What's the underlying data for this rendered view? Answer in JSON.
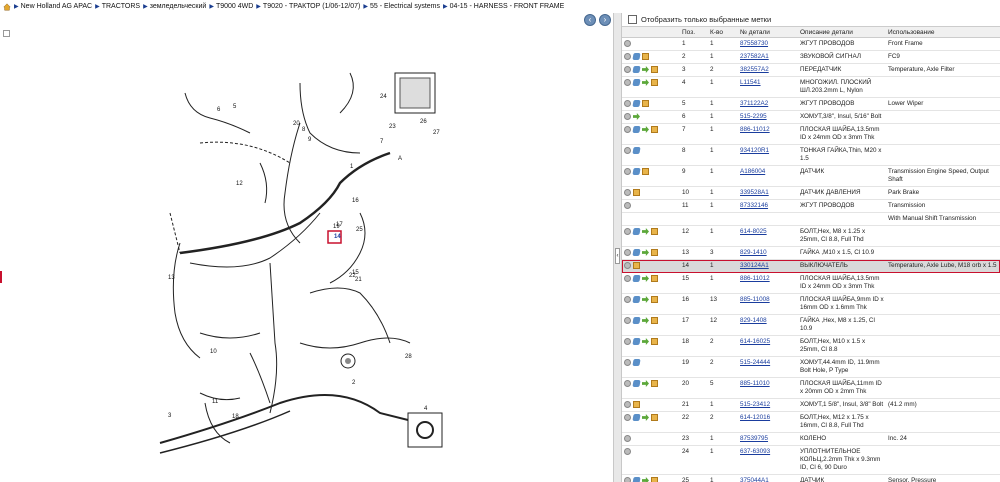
{
  "breadcrumb": [
    "New Holland AG APAC",
    "TRACTORS",
    "земледельческий",
    "T9000 4WD",
    "T9020 - ТРАКТОР (1/06-12/07)",
    "55 - Electrical systems",
    "04-15 - HARNESS - FRONT FRAME"
  ],
  "filter_label": "Отобразить только выбранные метки",
  "columns": [
    "Поз.",
    "К-во",
    "№ детали",
    "Описание детали",
    "Использование"
  ],
  "diagram_labels": [
    "1",
    "2",
    "3",
    "4",
    "5",
    "6",
    "7",
    "8",
    "9",
    "10",
    "11",
    "12",
    "13",
    "14",
    "15",
    "16",
    "17",
    "18",
    "19",
    "20",
    "21",
    "22",
    "23",
    "24",
    "25",
    "26",
    "27",
    "28",
    "A"
  ],
  "selected_pos": "14",
  "rows": [
    {
      "pos": "1",
      "qty": "1",
      "part": "87558730",
      "desc": "ЖГУТ ПРОВОДОВ",
      "use": "Front Frame",
      "icons": [
        "info"
      ]
    },
    {
      "pos": "2",
      "qty": "1",
      "part": "237582A1",
      "desc": "ЗВУКОВОЙ СИГНАЛ",
      "use": "FC9",
      "icons": [
        "info",
        "link",
        "box"
      ]
    },
    {
      "pos": "3",
      "qty": "2",
      "part": "382557A2",
      "desc": "ПЕРЕДАТЧИК",
      "use": "Temperature, Axle Filter",
      "icons": [
        "info",
        "link",
        "arrow",
        "box"
      ]
    },
    {
      "pos": "4",
      "qty": "1",
      "part": "L11541",
      "desc": "МНОГОЖИЛ. ПЛОСКИЙ ШЛ.203.2mm L, Nylon",
      "use": "",
      "icons": [
        "info",
        "link",
        "arrow",
        "box"
      ]
    },
    {
      "pos": "5",
      "qty": "1",
      "part": "371122A2",
      "desc": "ЖГУТ ПРОВОДОВ",
      "use": "Lower Wiper",
      "icons": [
        "info",
        "link",
        "box"
      ]
    },
    {
      "pos": "6",
      "qty": "1",
      "part": "515-2295",
      "desc": "ХОМУТ,3/8\", Insul, 5/16\" Bolt",
      "use": "",
      "icons": [
        "info",
        "arrow"
      ]
    },
    {
      "pos": "7",
      "qty": "1",
      "part": "886-11012",
      "desc": "ПЛОСКАЯ ШАЙБА,13.5mm ID x 24mm OD x 3mm Thk",
      "use": "",
      "icons": [
        "info",
        "link",
        "arrow",
        "box"
      ]
    },
    {
      "pos": "8",
      "qty": "1",
      "part": "934120R1",
      "desc": "ТОНКАЯ ГАЙКА,Thin, M20 x 1.5",
      "use": "",
      "icons": [
        "info",
        "link"
      ]
    },
    {
      "pos": "9",
      "qty": "1",
      "part": "A186004",
      "desc": "ДАТЧИК",
      "use": "Transmission Engine Speed, Output Shaft",
      "icons": [
        "info",
        "link",
        "box"
      ]
    },
    {
      "pos": "10",
      "qty": "1",
      "part": "339528A1",
      "desc": "ДАТЧИК ДАВЛЕНИЯ",
      "use": "Park Brake",
      "icons": [
        "info",
        "box"
      ]
    },
    {
      "pos": "11",
      "qty": "1",
      "part": "87332146",
      "desc": "ЖГУТ ПРОВОДОВ",
      "use": "Transmission",
      "icons": [
        "info"
      ]
    },
    {
      "pos": "",
      "qty": "",
      "part": "",
      "desc": "",
      "use": "With Manual Shift Transmission",
      "icons": []
    },
    {
      "pos": "12",
      "qty": "1",
      "part": "614-8025",
      "desc": "БОЛТ,Hex, M8 x 1.25 x 25mm, Cl 8.8, Full Thd",
      "use": "",
      "icons": [
        "info",
        "link",
        "arrow",
        "box"
      ]
    },
    {
      "pos": "13",
      "qty": "3",
      "part": "829-1410",
      "desc": "ГАЙКА ,M10 x 1.5, Cl 10.9",
      "use": "",
      "icons": [
        "info",
        "link",
        "arrow",
        "box"
      ]
    },
    {
      "pos": "14",
      "qty": "1",
      "part": "330124A1",
      "desc": "ВЫКЛЮЧАТЕЛЬ",
      "use": "Temperature, Axle Lube, M18 orb x 1.5",
      "icons": [
        "info",
        "box"
      ]
    },
    {
      "pos": "15",
      "qty": "1",
      "part": "886-11012",
      "desc": "ПЛОСКАЯ ШАЙБА,13.5mm ID x 24mm OD x 3mm Thk",
      "use": "",
      "icons": [
        "info",
        "link",
        "arrow",
        "box"
      ]
    },
    {
      "pos": "16",
      "qty": "13",
      "part": "885-11008",
      "desc": "ПЛОСКАЯ ШАЙБА,9mm ID x 16mm OD x 1.6mm Thk",
      "use": "",
      "icons": [
        "info",
        "link",
        "arrow",
        "box"
      ]
    },
    {
      "pos": "17",
      "qty": "12",
      "part": "829-1408",
      "desc": "ГАЙКА ,Hex, M8 x 1.25, Cl 10.9",
      "use": "",
      "icons": [
        "info",
        "link",
        "arrow",
        "box"
      ]
    },
    {
      "pos": "18",
      "qty": "2",
      "part": "614-16025",
      "desc": "БОЛТ,Hex, M10 x 1.5 x 25mm, Cl 8.8",
      "use": "",
      "icons": [
        "info",
        "link",
        "arrow",
        "box"
      ]
    },
    {
      "pos": "19",
      "qty": "2",
      "part": "515-24444",
      "desc": "ХОМУТ,44.4mm ID, 11.9mm Bolt Hole, P Type",
      "use": "",
      "icons": [
        "info",
        "link"
      ]
    },
    {
      "pos": "20",
      "qty": "5",
      "part": "885-11010",
      "desc": "ПЛОСКАЯ ШАЙБА,11mm ID x 20mm OD x 2mm Thk",
      "use": "",
      "icons": [
        "info",
        "link",
        "arrow",
        "box"
      ]
    },
    {
      "pos": "21",
      "qty": "1",
      "part": "515-23412",
      "desc": "ХОМУТ,1 5/8\", Insul, 3/8\" Bolt",
      "use": "(41.2 mm)",
      "icons": [
        "info",
        "box"
      ]
    },
    {
      "pos": "22",
      "qty": "2",
      "part": "614-12016",
      "desc": "БОЛТ,Hex, M12 x 1.75 x 16mm, Cl 8.8, Full Thd",
      "use": "",
      "icons": [
        "info",
        "link",
        "arrow",
        "box"
      ]
    },
    {
      "pos": "23",
      "qty": "1",
      "part": "87539795",
      "desc": "КОЛЕНО",
      "use": "Inc. 24",
      "icons": [
        "info"
      ]
    },
    {
      "pos": "24",
      "qty": "1",
      "part": "637-63093",
      "desc": "УПЛОТНИТЕЛЬНОЕ КОЛЬЦ,2.2mm Thk x 9.3mm ID, Cl 6, 90 Duro",
      "use": "",
      "icons": [
        "info"
      ]
    },
    {
      "pos": "25",
      "qty": "1",
      "part": "375044A1",
      "desc": "ДАТЧИК",
      "use": "Sensor, Pressure",
      "icons": [
        "info",
        "link",
        "arrow",
        "box"
      ]
    }
  ]
}
